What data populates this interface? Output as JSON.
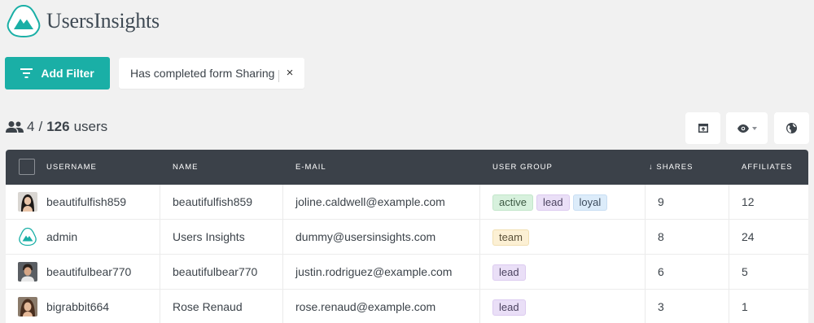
{
  "app": {
    "title": "UsersInsights"
  },
  "toolbar": {
    "add_filter_label": "Add Filter",
    "active_filter": "Has completed form Sharing",
    "remove_filter": "×"
  },
  "summary": {
    "shown": "4",
    "separator": "/",
    "total": "126",
    "unit": "users"
  },
  "table": {
    "columns": [
      "USERNAME",
      "NAME",
      "E-MAIL",
      "USER GROUP",
      "SHARES",
      "AFFILIATES"
    ],
    "sort_indicator": "↓",
    "rows": [
      {
        "username": "beautifulfish859",
        "name": "beautifulfish859",
        "email": "joline.caldwell@example.com",
        "groups": [
          "active",
          "lead",
          "loyal"
        ],
        "shares": "9",
        "affiliates": "12"
      },
      {
        "username": "admin",
        "name": "Users Insights",
        "email": "dummy@usersinsights.com",
        "groups": [
          "team"
        ],
        "shares": "8",
        "affiliates": "24"
      },
      {
        "username": "beautifulbear770",
        "name": "beautifulbear770",
        "email": "justin.rodriguez@example.com",
        "groups": [
          "lead"
        ],
        "shares": "6",
        "affiliates": "5"
      },
      {
        "username": "bigrabbit664",
        "name": "Rose Renaud",
        "email": "rose.renaud@example.com",
        "groups": [
          "lead"
        ],
        "shares": "3",
        "affiliates": "1"
      }
    ]
  },
  "colors": {
    "accent": "#1aafa6",
    "header_bg": "#3b4149",
    "page_bg": "#f1f1f1"
  },
  "icons": [
    "logo-icon",
    "filter-icon",
    "close-icon",
    "users-icon",
    "export-icon",
    "eye-icon",
    "globe-icon",
    "checkbox-icon"
  ]
}
